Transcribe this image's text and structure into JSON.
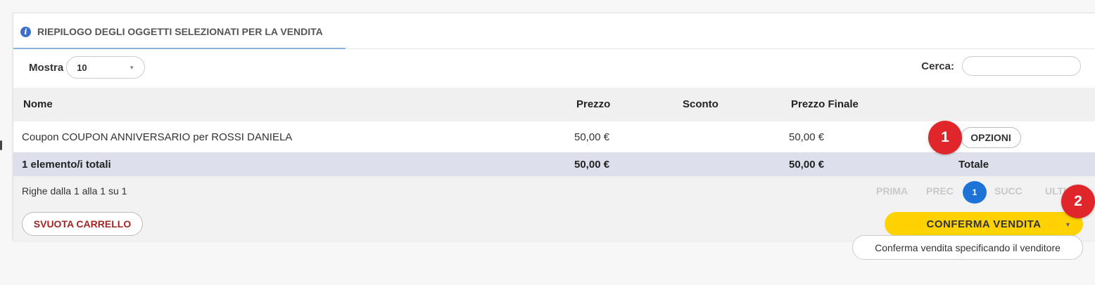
{
  "header": {
    "title": "RIEPILOGO DEGLI OGGETTI SELEZIONATI PER LA VENDITA",
    "icon": "info-icon"
  },
  "controls": {
    "show_label": "Mostra",
    "page_size": "10",
    "search_label": "Cerca:",
    "search_placeholder": ""
  },
  "table": {
    "columns": [
      "Nome",
      "Prezzo",
      "Sconto",
      "Prezzo Finale"
    ],
    "rows": [
      {
        "name": "Coupon COUPON ANNIVERSARIO per ROSSI DANIELA",
        "price": "50,00 €",
        "discount": "",
        "final_price": "50,00 €",
        "options_label": "OPZIONI"
      }
    ],
    "totals": {
      "count": "1 elemento/i totali",
      "price": "50,00 €",
      "final_price": "50,00 €",
      "label": "Totale"
    }
  },
  "pagination": {
    "info": "Righe dalla 1 alla 1 su 1",
    "first": "PRIMA",
    "prev": "PREC",
    "current": "1",
    "next": "SUCC",
    "last": "ULTI"
  },
  "actions": {
    "clear_cart": "SVUOTA CARRELLO",
    "confirm_sale": "CONFERMA VENDITA",
    "confirm_tooltip": "Conferma vendita specificando il venditore"
  },
  "markers": [
    "1",
    "2"
  ],
  "colors": {
    "accent_blue": "#1e73d6",
    "confirm_yellow": "#ffd200",
    "marker_red": "#e0262a",
    "clear_text": "#a32626"
  }
}
